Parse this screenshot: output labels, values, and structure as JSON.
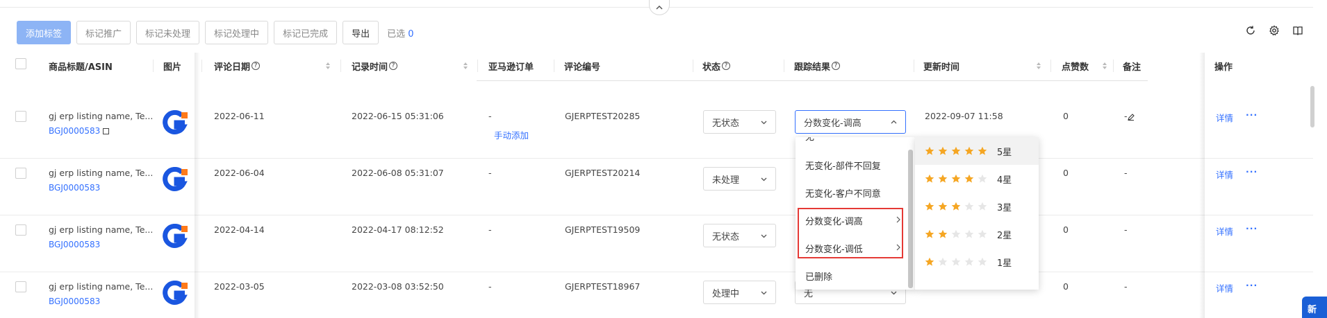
{
  "toolbar": {
    "add_tag": "添加标签",
    "mark_promote": "标记推广",
    "mark_unprocessed": "标记未处理",
    "mark_processing": "标记处理中",
    "mark_done": "标记已完成",
    "export": "导出",
    "selected_prefix": "已选",
    "selected_count": "0"
  },
  "table": {
    "headers": {
      "product": "商品标题/ASIN",
      "image": "图片",
      "review_date": "评论日期",
      "record_time": "记录时间",
      "amazon_order": "亚马逊订单",
      "review_id": "评论编号",
      "status": "状态",
      "tracking": "跟踪结果",
      "update_time": "更新时间",
      "likes": "点赞数",
      "note": "备注",
      "actions": "操作"
    },
    "rows": [
      {
        "title": "gj erp listing name, Te...",
        "asin": "BGJ0000583",
        "review_date": "2022-06-11",
        "record_time": "2022-06-15 05:31:06",
        "order": "-",
        "order_link": "手动添加",
        "review_id": "GJERPTEST20285",
        "status": "无状态",
        "tracking": "分数变化-调高",
        "update_time": "2022-09-07 11:58",
        "likes": "0",
        "note": "-",
        "detail": "详情",
        "more": "···"
      },
      {
        "title": "gj erp listing name, Te...",
        "asin": "BGJ0000583",
        "review_date": "2022-06-04",
        "record_time": "2022-06-08 05:31:07",
        "order": "-",
        "review_id": "GJERPTEST20214",
        "status": "未处理",
        "likes": "0",
        "note": "-",
        "detail": "详情",
        "more": "···"
      },
      {
        "title": "gj erp listing name, Te...",
        "asin": "BGJ0000583",
        "review_date": "2022-04-14",
        "record_time": "2022-04-17 08:12:52",
        "order": "-",
        "review_id": "GJERPTEST19509",
        "status": "无状态",
        "likes": "0",
        "note": "-",
        "detail": "详情",
        "more": "···"
      },
      {
        "title": "gj erp listing name, Te...",
        "asin": "BGJ0000583",
        "review_date": "2022-03-05",
        "record_time": "2022-03-08 03:52:50",
        "order": "-",
        "review_id": "GJERPTEST18967",
        "status": "处理中",
        "tracking": "无",
        "likes": "0",
        "note": "-",
        "detail": "详情",
        "more": "···"
      }
    ]
  },
  "dropdown": {
    "items": [
      "无",
      "无变化-部件不回复",
      "无变化-客户不同意",
      "分数变化-调高",
      "分数变化-调低",
      "已删除"
    ],
    "submenu": [
      {
        "label": "5星",
        "stars": 5
      },
      {
        "label": "4星",
        "stars": 4
      },
      {
        "label": "3星",
        "stars": 3
      },
      {
        "label": "2星",
        "stars": 2
      },
      {
        "label": "1星",
        "stars": 1
      }
    ]
  },
  "new_badge": "新",
  "colors": {
    "primary": "#3370ff",
    "primary_light": "#8db4f5",
    "star": "#f5a623",
    "star_empty": "#e6e6e6",
    "highlight": "#e53935"
  }
}
